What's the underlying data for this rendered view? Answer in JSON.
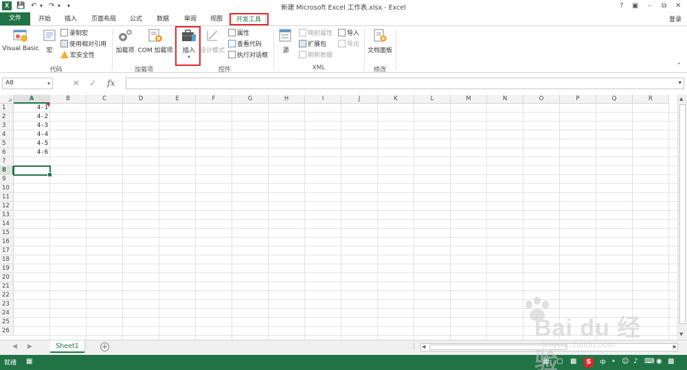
{
  "window": {
    "title": "新建 Microsoft Excel 工作表.xlsx - Excel",
    "help": "?",
    "login": "登录"
  },
  "tabs": [
    {
      "label": "文件"
    },
    {
      "label": "开始"
    },
    {
      "label": "插入"
    },
    {
      "label": "页面布局"
    },
    {
      "label": "公式"
    },
    {
      "label": "数据"
    },
    {
      "label": "审阅"
    },
    {
      "label": "视图"
    },
    {
      "label": "开发工具"
    }
  ],
  "ribbon": {
    "code_group": {
      "label": "代码",
      "visual_basic": "Visual Basic",
      "macros": "宏",
      "record_macro": "录制宏",
      "relative_refs": "使用相对引用",
      "macro_security": "宏安全性"
    },
    "addins_group": {
      "label": "加载项",
      "addins": "加载项",
      "com_addins": "COM 加载项"
    },
    "controls_group": {
      "label": "控件",
      "insert": "插入",
      "design_mode": "设计模式",
      "properties": "属性",
      "view_code": "查看代码",
      "run_dialog": "执行对话框"
    },
    "xml_group": {
      "label": "XML",
      "source": "源",
      "map_properties": "映射属性",
      "expansion_packs": "扩展包",
      "refresh_data": "刷新数据",
      "import": "导入",
      "export": "导出"
    },
    "modify_group": {
      "label": "修改",
      "document_panel": "文档面板"
    }
  },
  "formula_bar": {
    "name_box": "A8",
    "fx": "fx",
    "value": ""
  },
  "sheet": {
    "columns": [
      "A",
      "B",
      "C",
      "D",
      "E",
      "F",
      "G",
      "H",
      "I",
      "J",
      "K",
      "L",
      "M",
      "N",
      "O",
      "P",
      "Q",
      "R"
    ],
    "rows": [
      "1",
      "2",
      "3",
      "4",
      "5",
      "6",
      "7",
      "8",
      "9",
      "10",
      "11",
      "12",
      "13",
      "14",
      "15",
      "16",
      "17",
      "18",
      "19",
      "20",
      "21",
      "22",
      "23",
      "24",
      "25",
      "26"
    ],
    "cells_A": [
      "4-1",
      "4-2",
      "4-3",
      "4-4",
      "4-5",
      "4-6"
    ],
    "selected_cell": "A8",
    "selected_row": "8",
    "selected_col": "A"
  },
  "sheet_tabs": {
    "active": "Sheet1",
    "add": "+"
  },
  "status": {
    "ready": "就绪"
  },
  "watermark": {
    "text": "Bai du 经验",
    "sub": "jingyan.baidu.com"
  },
  "colors": {
    "excel_green": "#217346",
    "highlight_red": "#e0262b"
  }
}
